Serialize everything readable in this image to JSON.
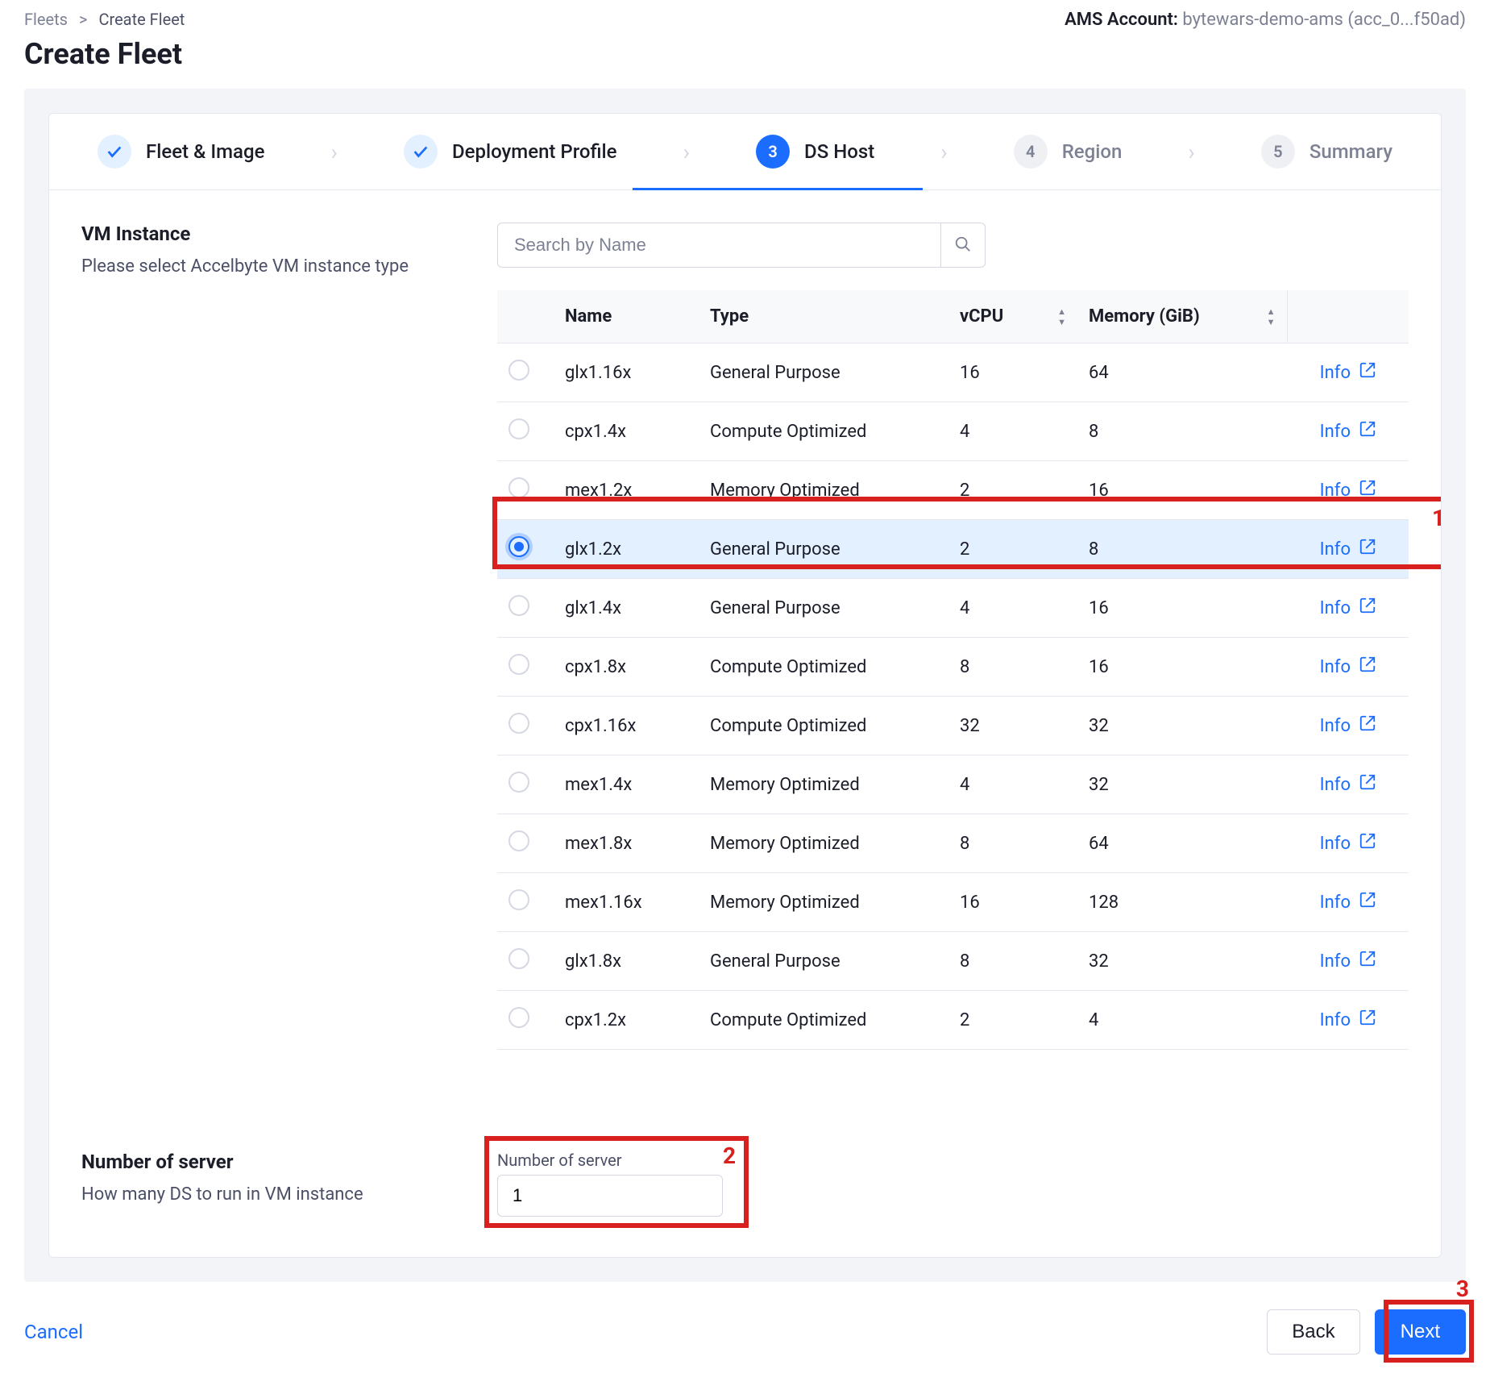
{
  "breadcrumb": {
    "root": "Fleets",
    "sep": ">",
    "current": "Create Fleet"
  },
  "page_title": "Create Fleet",
  "account": {
    "label": "AMS Account:",
    "value": "bytewars-demo-ams (acc_0...f50ad)"
  },
  "stepper": {
    "items": [
      {
        "label": "Fleet & Image",
        "state": "done"
      },
      {
        "label": "Deployment Profile",
        "state": "done"
      },
      {
        "label": "DS Host",
        "state": "active",
        "num": "3"
      },
      {
        "label": "Region",
        "state": "todo",
        "num": "4"
      },
      {
        "label": "Summary",
        "state": "todo",
        "num": "5"
      }
    ]
  },
  "vm_section": {
    "title": "VM Instance",
    "subtitle": "Please select Accelbyte VM instance type",
    "search_placeholder": "Search by Name",
    "columns": {
      "name": "Name",
      "type": "Type",
      "vcpu": "vCPU",
      "memory": "Memory (GiB)",
      "info_label": "Info"
    },
    "rows": [
      {
        "name": "glx1.16x",
        "type": "General Purpose",
        "vcpu": "16",
        "memory": "64",
        "selected": false
      },
      {
        "name": "cpx1.4x",
        "type": "Compute Optimized",
        "vcpu": "4",
        "memory": "8",
        "selected": false
      },
      {
        "name": "mex1.2x",
        "type": "Memory Optimized",
        "vcpu": "2",
        "memory": "16",
        "selected": false
      },
      {
        "name": "glx1.2x",
        "type": "General Purpose",
        "vcpu": "2",
        "memory": "8",
        "selected": true
      },
      {
        "name": "glx1.4x",
        "type": "General Purpose",
        "vcpu": "4",
        "memory": "16",
        "selected": false
      },
      {
        "name": "cpx1.8x",
        "type": "Compute Optimized",
        "vcpu": "8",
        "memory": "16",
        "selected": false
      },
      {
        "name": "cpx1.16x",
        "type": "Compute Optimized",
        "vcpu": "32",
        "memory": "32",
        "selected": false
      },
      {
        "name": "mex1.4x",
        "type": "Memory Optimized",
        "vcpu": "4",
        "memory": "32",
        "selected": false
      },
      {
        "name": "mex1.8x",
        "type": "Memory Optimized",
        "vcpu": "8",
        "memory": "64",
        "selected": false
      },
      {
        "name": "mex1.16x",
        "type": "Memory Optimized",
        "vcpu": "16",
        "memory": "128",
        "selected": false
      },
      {
        "name": "glx1.8x",
        "type": "General Purpose",
        "vcpu": "8",
        "memory": "32",
        "selected": false
      },
      {
        "name": "cpx1.2x",
        "type": "Compute Optimized",
        "vcpu": "2",
        "memory": "4",
        "selected": false
      }
    ]
  },
  "ns_section": {
    "title": "Number of server",
    "subtitle": "How many DS to run in VM instance",
    "field_label": "Number of server",
    "value": "1"
  },
  "footer": {
    "cancel": "Cancel",
    "back": "Back",
    "next": "Next"
  },
  "annotations": {
    "a1": "1",
    "a2": "2",
    "a3": "3"
  }
}
